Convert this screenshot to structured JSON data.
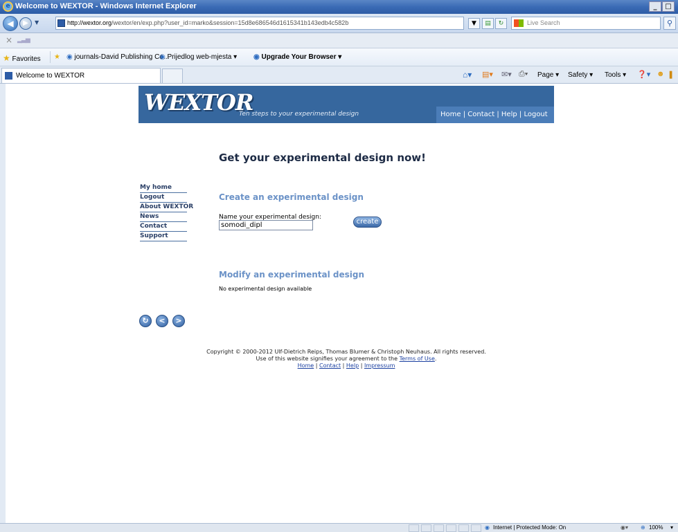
{
  "window": {
    "title": "Welcome to WEXTOR - Windows Internet Explorer",
    "controls": [
      "_",
      "□"
    ]
  },
  "address_bar": {
    "url_host": "http://wextor.org",
    "url_rest": "/wextor/en/exp.php?user_id=marko&session=15d8e686546d1615341b143edb4c582b",
    "search_placeholder": "Live Search"
  },
  "favorites_bar": {
    "favorites_label": "Favorites",
    "items": [
      "journals-David Publishing Co...",
      "Prijedlog web-mjesta ▾",
      "Upgrade Your Browser ▾"
    ]
  },
  "tab": {
    "title": "Welcome to WEXTOR"
  },
  "command_bar": {
    "page": "Page ▾",
    "safety": "Safety ▾",
    "tools": "Tools ▾"
  },
  "site": {
    "logo": "WEXTOR",
    "tagline": "Ten steps to your experimental design",
    "nav": {
      "home": "Home",
      "contact": "Contact",
      "help": "Help",
      "logout": "Logout",
      "sep": " | "
    }
  },
  "main": {
    "heading": "Get your experimental design now!",
    "create_title": "Create an experimental design",
    "name_label": "Name your experimental design:",
    "name_value": "somodi_dipl",
    "create_button": "create",
    "modify_title": "Modify an experimental design",
    "no_design": "No experimental design available"
  },
  "sidenav": [
    "My home",
    "Logout",
    "About WEXTOR",
    "News",
    "Contact",
    "Support"
  ],
  "footer": {
    "copyright": "Copyright © 2000-2012 Ulf-Dietrich Reips, Thomas Blumer & Christoph Neuhaus. All rights reserved.",
    "terms_prefix": "Use of this website signifies your agreement to the ",
    "terms_link": "Terms of Use",
    "terms_suffix": ".",
    "links": [
      "Home",
      "Contact",
      "Help",
      "Impressum"
    ],
    "sep": " | "
  },
  "status_bar": {
    "zone": "Internet | Protected Mode: On",
    "zoom": "100%"
  },
  "colors": {
    "banner": "#36679e",
    "accent": "#6b92c7"
  }
}
